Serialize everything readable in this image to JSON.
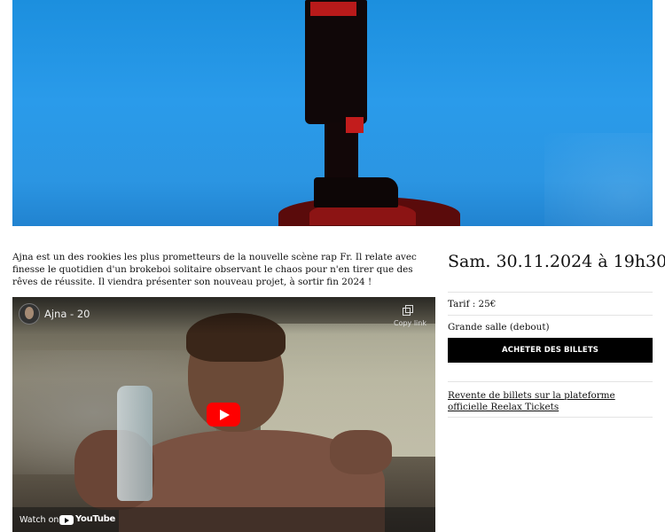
{
  "event": {
    "description": "Ajna est un des rookies les plus prometteurs de la nouvelle scène rap Fr. Il relate avec finesse le quotidien d'un brokeboi solitaire observant le chaos pour n'en tirer que des rêves de réussite. Il viendra présenter son nouveau projet, à sortir fin 2024 !",
    "date": "Sam. 30.11.2024 à 19h30",
    "tarif": "Tarif : 25€",
    "venue": "Grande salle (debout)",
    "buy_button": "ACHETER DES BILLETS",
    "resale_link": "Revente de billets sur la plateforme officielle Reelax Tickets"
  },
  "video": {
    "title": "Ajna - 20",
    "copy_link": "Copy link",
    "watch_on": "Watch on",
    "youtube": "YouTube"
  },
  "icons": {
    "copy": "copy-icon",
    "play": "play-icon",
    "youtube": "youtube-logo-icon"
  },
  "colors": {
    "hero_blue": "#2a9bea",
    "button_bg": "#000000",
    "play_red": "#ff0000"
  }
}
